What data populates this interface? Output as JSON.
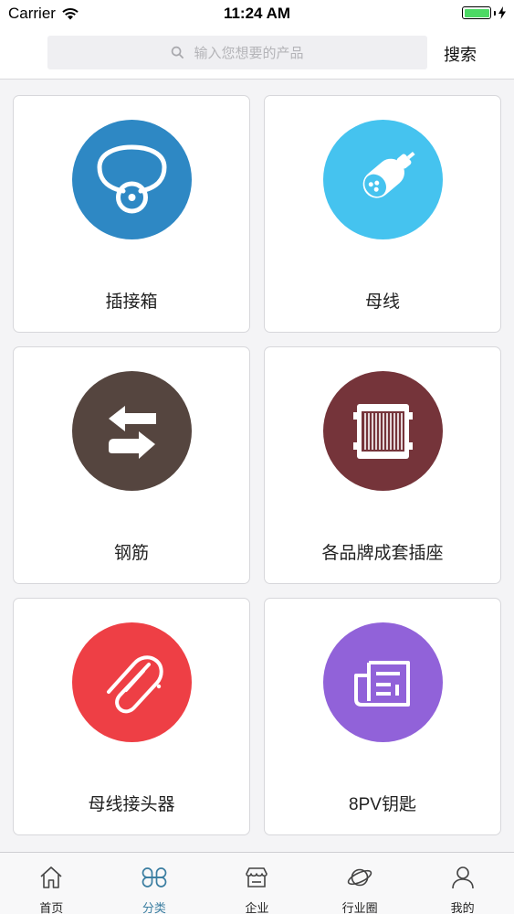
{
  "status_bar": {
    "carrier": "Carrier",
    "time": "11:24 AM"
  },
  "search": {
    "placeholder": "输入您想要的产品",
    "button_label": "搜索"
  },
  "categories": [
    {
      "label": "插接箱",
      "icon": "plug-box-icon",
      "color": "#2e88c4"
    },
    {
      "label": "母线",
      "icon": "busbar-icon",
      "color": "#45c3ef"
    },
    {
      "label": "钢筋",
      "icon": "swap-arrows-icon",
      "color": "#55453f"
    },
    {
      "label": "各品牌成套插座",
      "icon": "socket-panel-icon",
      "color": "#75343a"
    },
    {
      "label": "母线接头器",
      "icon": "paperclip-icon",
      "color": "#ee3f45"
    },
    {
      "label": "8PV钥匙",
      "icon": "document-icon",
      "color": "#9162d9"
    }
  ],
  "tabbar": {
    "items": [
      {
        "label": "首页",
        "icon": "home-icon"
      },
      {
        "label": "分类",
        "icon": "category-icon",
        "active": true
      },
      {
        "label": "企业",
        "icon": "store-icon"
      },
      {
        "label": "行业圈",
        "icon": "planet-icon"
      },
      {
        "label": "我的",
        "icon": "user-icon"
      }
    ]
  }
}
